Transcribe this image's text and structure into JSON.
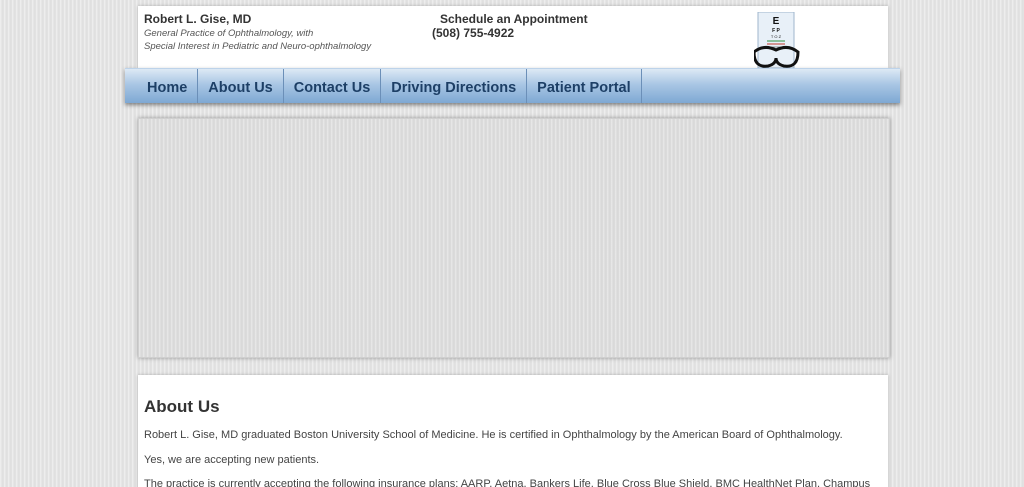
{
  "header": {
    "doctor_name": "Robert L. Gise, MD",
    "description_line1": "General Practice of Ophthalmology, with",
    "description_line2": "Special Interest in Pediatric and Neuro-ophthalmology",
    "appointment_title": "Schedule an Appointment",
    "appointment_phone": "(508) 755-4922",
    "logo_icon": "eye-chart-glasses-icon"
  },
  "nav": {
    "items": [
      {
        "label": "Home"
      },
      {
        "label": "About Us"
      },
      {
        "label": "Contact Us"
      },
      {
        "label": "Driving Directions"
      },
      {
        "label": "Patient Portal"
      }
    ]
  },
  "content": {
    "heading": "About Us",
    "paragraphs": [
      "Robert L. Gise, MD graduated Boston University School of Medicine. He is certified in Ophthalmology by the American Board of Ophthalmology.",
      "Yes, we are accepting new patients.",
      "The practice is currently accepting the following insurance plans:  AARP, Aetna, Bankers Life, Blue Cross Blue Shield, BMC HealthNet Plan, Champus"
    ]
  },
  "colors": {
    "nav_text": "#1d3f66",
    "nav_gradient_top": "#dde9f5",
    "nav_gradient_bottom": "#7ea8d3",
    "page_background": "#e3e3e3"
  }
}
